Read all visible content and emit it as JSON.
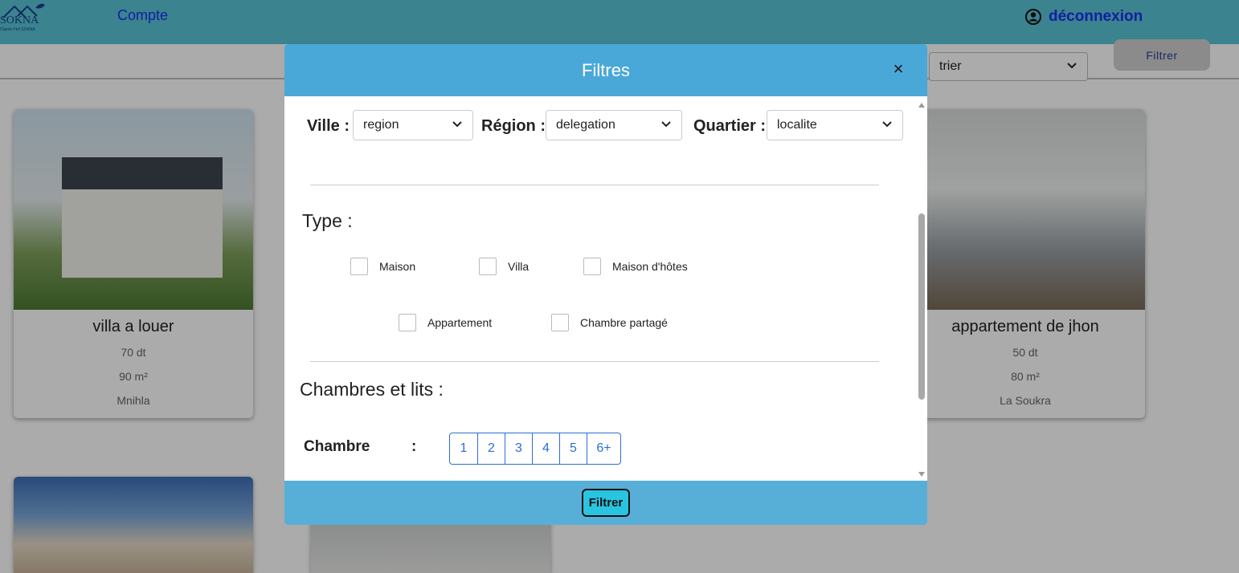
{
  "header": {
    "logo_text": "SOKNA",
    "logo_sub": "l'Santé Fief SOKNA",
    "nav_compte": "Compte",
    "logout_label": "déconnexion"
  },
  "toolbar": {
    "sort_value": "trier",
    "filter_label": "Filtrer"
  },
  "listings": [
    {
      "title": "villa a louer",
      "price": "70 dt",
      "area": "90 m²",
      "location": "Mnihla"
    },
    {
      "title": "appartement de jhon",
      "price": "50 dt",
      "area": "80 m²",
      "location": "La Soukra"
    }
  ],
  "modal": {
    "title": "Filtres",
    "close": "×",
    "location": {
      "ville_label": "Ville :",
      "ville_value": "region",
      "region_label": "Région :",
      "region_value": "delegation",
      "quartier_label": "Quartier :",
      "quartier_value": "localite"
    },
    "type": {
      "title": "Type :",
      "options": [
        "Maison",
        "Villa",
        "Maison d'hôtes",
        "Appartement",
        "Chambre partagé"
      ]
    },
    "rooms": {
      "title": "Chambres et lits :",
      "chambre_label": "Chambre",
      "colon": ":",
      "buttons": [
        "1",
        "2",
        "3",
        "4",
        "5",
        "6+"
      ]
    },
    "footer_button": "Filtrer"
  },
  "colors": {
    "topbar": "#58c4d6",
    "modal_header": "#4aa8d8",
    "modal_footer": "#57afd8",
    "link": "#1a2ff0",
    "accent_blue": "#2a6fd6",
    "footer_button": "#29c4e0"
  },
  "icons": {
    "logout": "user-circle-icon",
    "select_caret": "chevron-down-icon",
    "close": "close-icon",
    "logo": "house-logo-icon"
  }
}
